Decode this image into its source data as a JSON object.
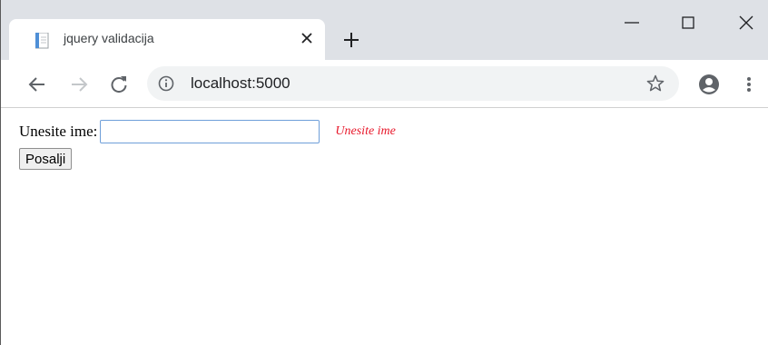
{
  "browser": {
    "tab_title": "jquery validacija",
    "url": "localhost:5000"
  },
  "form": {
    "label": "Unesite ime:",
    "input_value": "",
    "error": "Unesite ime",
    "submit_label": "Posalji"
  },
  "colors": {
    "tabstrip": "#dee1e6",
    "omnibox": "#f1f3f4",
    "error": "#e8182b",
    "input_focus": "#6f9fd9"
  }
}
